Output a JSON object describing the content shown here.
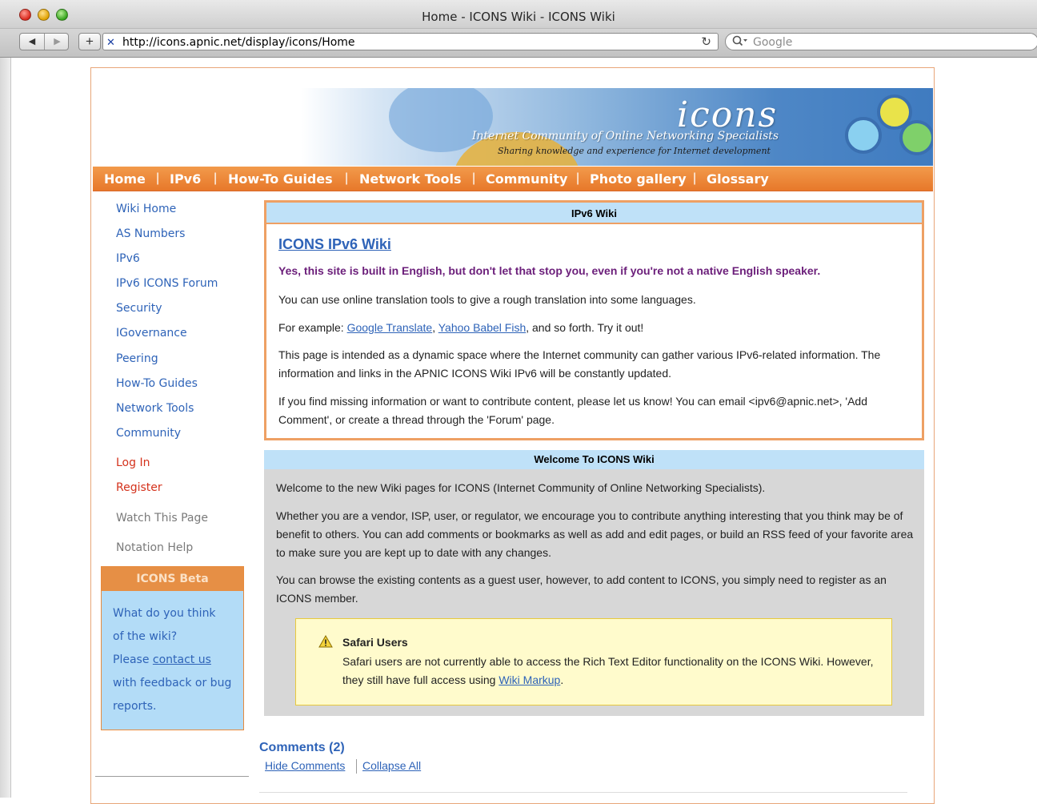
{
  "window": {
    "title": "Home - ICONS Wiki - ICONS Wiki"
  },
  "toolbar": {
    "back_icon": "◀",
    "forward_icon": "▶",
    "add_icon": "+",
    "url": "http://icons.apnic.net/display/icons/Home",
    "search_placeholder": "Google"
  },
  "banner": {
    "logo": "icons",
    "tagline": "Internet Community of Online Networking Specialists",
    "subtagline": "Sharing knowledge and experience for Internet development"
  },
  "topnav": {
    "items": [
      "Home",
      "IPv6",
      "How-To Guides",
      "Network Tools",
      "Community",
      "Photo gallery",
      "Glossary"
    ]
  },
  "sidebar": {
    "links": [
      "Wiki Home",
      "AS Numbers",
      "IPv6",
      "IPv6 ICONS Forum",
      "Security",
      "IGovernance",
      "Peering",
      "How-To Guides",
      "Network Tools",
      "Community"
    ],
    "login": "Log In",
    "register": "Register",
    "watch": "Watch This Page",
    "notation": "Notation Help",
    "beta": {
      "title": "ICONS Beta",
      "line1": "What do you think",
      "line2": "of the wiki?",
      "line3_prefix": "Please ",
      "line3_link": "contact us",
      "line4": "with feedback or bug",
      "line5": "reports."
    }
  },
  "panel_ipv6": {
    "header": "IPv6 Wiki",
    "title": "ICONS IPv6 Wiki",
    "note": "Yes, this site is built in English, but don't let that stop you, even if you're not a native English speaker.",
    "p1": "You can use online translation tools to give a rough translation into some languages.",
    "p2_prefix": "For example: ",
    "p2_link1": "Google Translate",
    "p2_comma": ", ",
    "p2_link2": "Yahoo Babel Fish",
    "p2_suffix": ", and so forth. Try it out!",
    "p3": "This page is intended as a dynamic space where the Internet community can gather various IPv6-related information. The information and links in the APNIC ICONS Wiki IPv6 will be constantly updated.",
    "p4": "If you find missing information or want to contribute content, please let us know! You can email <ipv6@apnic.net>, 'Add Comment', or create a thread through the 'Forum' page."
  },
  "panel_welcome": {
    "header": "Welcome To ICONS Wiki",
    "p1": "Welcome to the new Wiki pages for ICONS (Internet Community of Online Networking Specialists).",
    "p2": "Whether you are a vendor, ISP, user, or regulator, we encourage you to contribute anything interesting that you think may be of benefit to others. You can add comments or bookmarks as well as add and edit pages, or build an RSS feed of your favorite area to make sure you are kept up to date with any changes.",
    "p3": "You can browse the existing contents as a guest user, however, to add content to ICONS, you simply need to register as an ICONS member.",
    "note_title": "Safari Users",
    "note_prefix": "Safari users are not currently able to access the Rich Text Editor functionality on the ICONS Wiki. However, they still have full access using ",
    "note_link": "Wiki Markup",
    "note_suffix": "."
  },
  "comments": {
    "title": "Comments (2)",
    "hide": "Hide Comments",
    "collapse": "Collapse All"
  },
  "colors": {
    "nav_orange": "#e7782a",
    "link_blue": "#2e63b8",
    "header_blue": "#bfe1f8",
    "panel_border": "#eea064",
    "note_purple": "#6b1e7a"
  }
}
